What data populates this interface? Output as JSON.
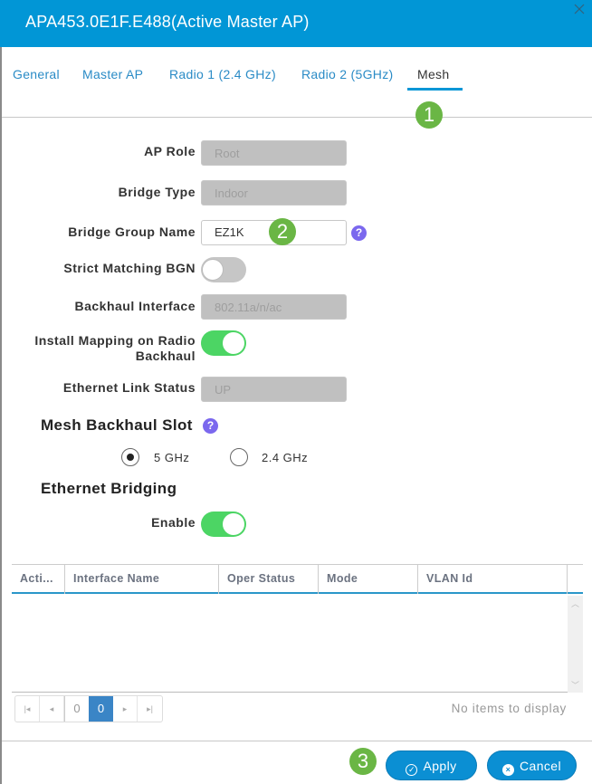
{
  "dialog": {
    "title": "APA453.0E1F.E488(Active Master AP)",
    "close_icon": "close-icon"
  },
  "tabs": [
    {
      "label": "General",
      "active": false
    },
    {
      "label": "Master AP",
      "active": false
    },
    {
      "label": "Radio 1 (2.4 GHz)",
      "active": false
    },
    {
      "label": "Radio 2 (5GHz)",
      "active": false
    },
    {
      "label": "Mesh",
      "active": true
    }
  ],
  "badges": {
    "one": "1",
    "two": "2",
    "three": "3"
  },
  "form": {
    "ap_role": {
      "label": "AP Role",
      "value": "Root"
    },
    "bridge_type": {
      "label": "Bridge Type",
      "value": "Indoor"
    },
    "bridge_group_name": {
      "label": "Bridge Group Name",
      "value": "EZ1K"
    },
    "strict_matching_bgn": {
      "label": "Strict Matching BGN",
      "enabled": false
    },
    "backhaul_interface": {
      "label": "Backhaul Interface",
      "value": "802.11a/n/ac"
    },
    "install_mapping": {
      "label_line1": "Install Mapping on Radio",
      "label_line2": "Backhaul",
      "enabled": true
    },
    "ethernet_link_status": {
      "label": "Ethernet Link Status",
      "value": "UP"
    }
  },
  "mesh_backhaul_slot": {
    "title": "Mesh Backhaul Slot",
    "options": [
      {
        "label": "5 GHz",
        "checked": true
      },
      {
        "label": "2.4 GHz",
        "checked": false
      }
    ]
  },
  "ethernet_bridging": {
    "title": "Ethernet Bridging",
    "enable_label": "Enable",
    "enabled": true
  },
  "table": {
    "columns": [
      "Acti...",
      "Interface Name",
      "Oper Status",
      "Mode",
      "VLAN Id"
    ],
    "rows": []
  },
  "pager": {
    "first": "|◂",
    "prev": "◂",
    "current_from": "0",
    "current_page": "0",
    "next": "▸",
    "last": "▸|",
    "status": "No items to display"
  },
  "footer": {
    "apply_label": "Apply",
    "cancel_label": "Cancel"
  },
  "colors": {
    "header": "#0196d6",
    "accent": "#0b8fd3",
    "toggle_on": "#4cd564",
    "badge": "#6ab645",
    "help": "#7b68ee"
  }
}
